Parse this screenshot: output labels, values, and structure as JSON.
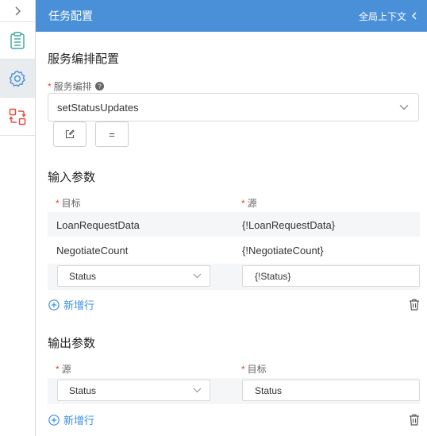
{
  "header": {
    "title": "任务配置",
    "context_label": "全局上下文"
  },
  "service": {
    "section_title": "服务编排配置",
    "label": "服务编排",
    "selected": "setStatusUpdates",
    "button_equals": "="
  },
  "input_params": {
    "section_title": "输入参数",
    "col_target": "目标",
    "col_source": "源",
    "rows": [
      {
        "target": "LoanRequestData",
        "source": "{!LoanRequestData}"
      },
      {
        "target": "NegotiateCount",
        "source": "{!NegotiateCount}"
      }
    ],
    "edit_row": {
      "target": "Status",
      "source": "{!Status}"
    },
    "add_label": "新增行"
  },
  "output_params": {
    "section_title": "输出参数",
    "col_source": "源",
    "col_target": "目标",
    "edit_row": {
      "source": "Status",
      "target": "Status"
    },
    "add_label": "新增行"
  },
  "colors": {
    "header_bg": "#4a90d9",
    "accent": "#3a8ee6",
    "required": "#e0473b",
    "rail_icon_teal": "#3aa99f",
    "rail_icon_blue": "#4a90d9",
    "rail_icon_red": "#e0473b"
  }
}
